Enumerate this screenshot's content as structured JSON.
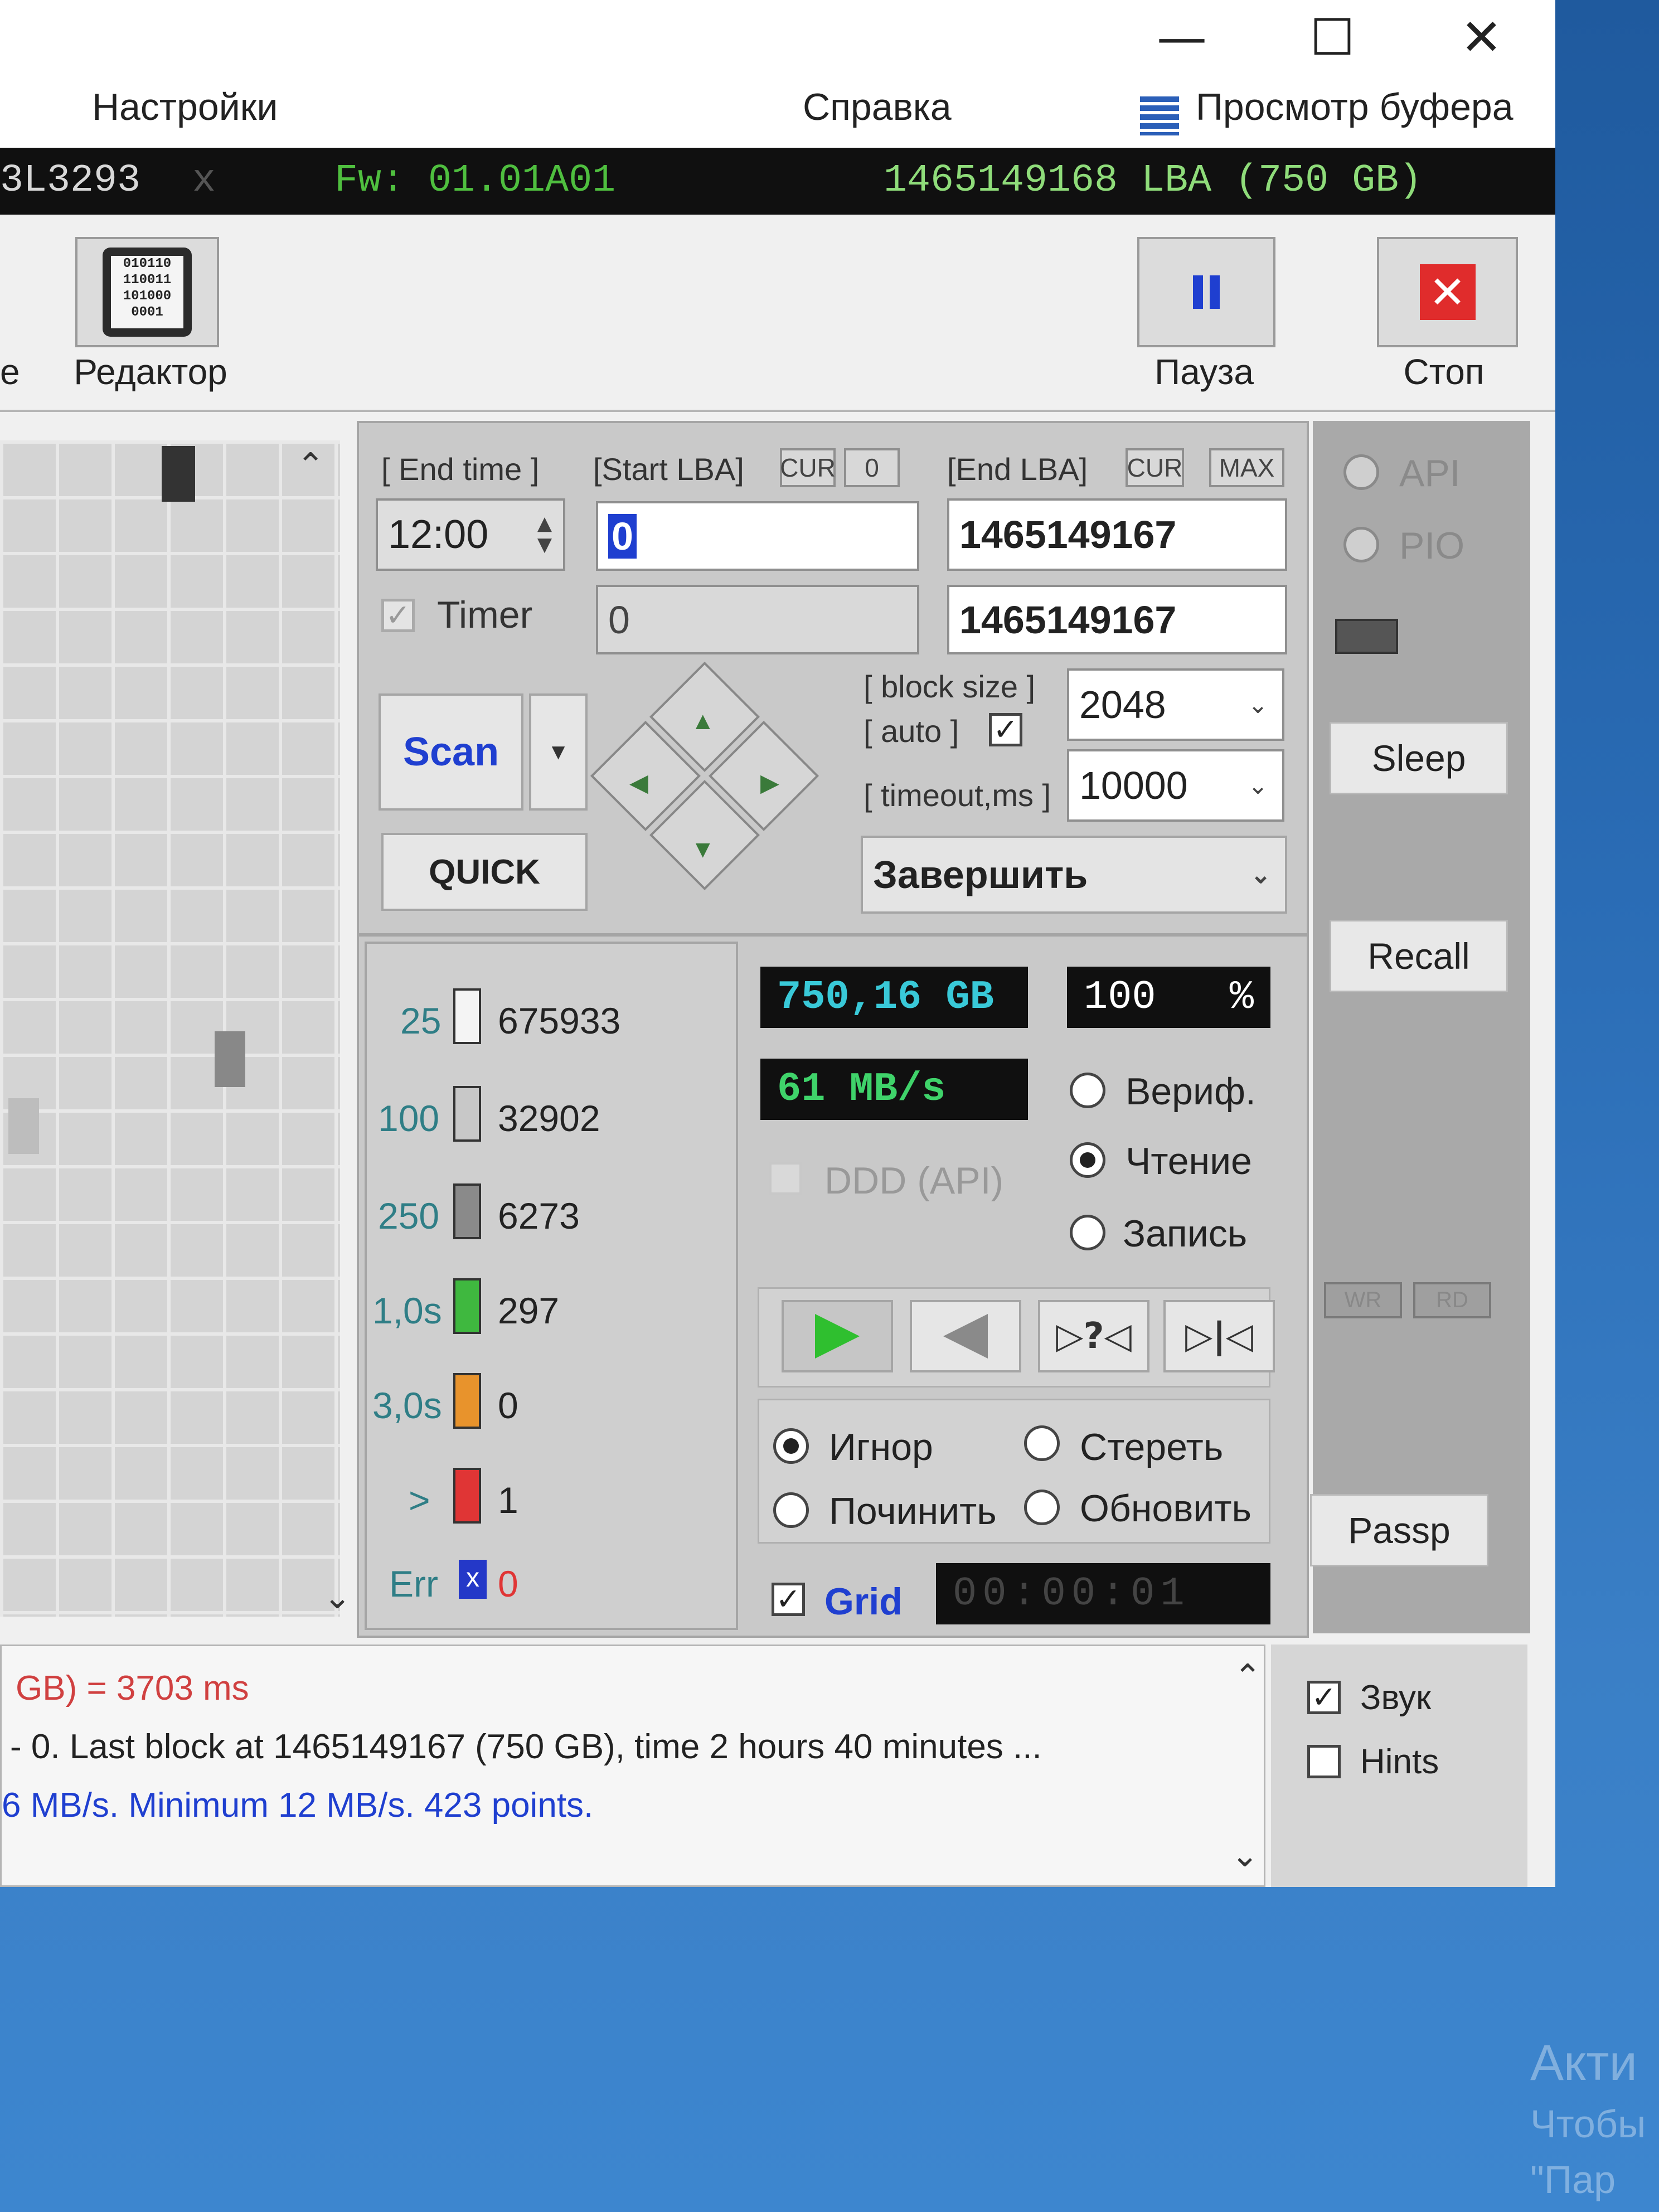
{
  "window_controls": {
    "minimize": "—",
    "maximize": "☐",
    "close": "✕"
  },
  "menu": {
    "settings": "Настройки",
    "help": "Справка",
    "buffer_view": "Просмотр буфера"
  },
  "infobar": {
    "model_fragment": "3L3293",
    "close_mark": "x",
    "firmware": "Fw: 01.01A01",
    "capacity": "1465149168 LBA (750 GB)"
  },
  "toolbar": {
    "left_fragment": "e",
    "editor": "Редактор",
    "editor_icon_text": "010110\n110011\n101000\n0001",
    "pause": "Пауза",
    "stop": "Стоп"
  },
  "scan_panel": {
    "end_time_label": "[ End time ]",
    "end_time_value": "12:00",
    "start_lba_label": "[Start LBA]",
    "cur1": "CUR",
    "zero_btn": "0",
    "end_lba_label": "[End LBA]",
    "cur2": "CUR",
    "max": "MAX",
    "start_lba_value": "0",
    "end_lba_value": "1465149167",
    "timer_label": "Timer",
    "timer_start_value": "0",
    "timer_end_value": "1465149167",
    "scan_button": "Scan",
    "quick_button": "QUICK",
    "block_size_label": "[ block size ]",
    "auto_label": "[ auto ]",
    "block_size_value": "2048",
    "timeout_label": "[ timeout,ms ]",
    "timeout_value": "10000",
    "finish_select": "Завершить"
  },
  "legend": [
    {
      "threshold": "25",
      "count": "675933",
      "color": "#f4f4f4"
    },
    {
      "threshold": "100",
      "count": "32902",
      "color": "#c8c8c8"
    },
    {
      "threshold": "250",
      "count": "6273",
      "color": "#8a8a8a"
    },
    {
      "threshold": "1,0s",
      "count": "297",
      "color": "#3fb83f"
    },
    {
      "threshold": "3,0s",
      "count": "0",
      "color": "#e8932c"
    },
    {
      "threshold": ">",
      "count": "1",
      "color": "#e03535"
    },
    {
      "threshold": "Err",
      "count": "0",
      "color": "#2438c8"
    }
  ],
  "stats": {
    "size": "750,16 GB",
    "percent": "100",
    "percent_sign": "%",
    "speed": "61 MB/s",
    "ddd": "DDD (API)"
  },
  "mode": {
    "verify": "Вериф.",
    "read": "Чтение",
    "write": "Запись"
  },
  "actions": {
    "ignore": "Игнор",
    "erase": "Стереть",
    "repair": "Починить",
    "refresh": "Обновить"
  },
  "grid": {
    "label": "Grid",
    "timer": "00:00:01"
  },
  "right_panel": {
    "api": "API",
    "pio": "PIO",
    "sleep": "Sleep",
    "recall": "Recall",
    "wr": "WR",
    "rd": "RD",
    "passp": "Passp"
  },
  "log": {
    "line1": "GB)  = 3703 ms",
    "line2": "- 0. Last block at 1465149167 (750 GB), time 2 hours 40 minutes ...",
    "line3": "6 MB/s. Minimum 12 MB/s. 423 points."
  },
  "options": {
    "sound": "Звук",
    "hints": "Hints"
  },
  "desktop_watermark": {
    "line1": "Акти",
    "line2": "Чтобы",
    "line3": "\"Пар"
  },
  "colors": {
    "lcd_cyan": "#39c9d8",
    "lcd_green": "#3fd36a",
    "lba_green": "#8fdc7a",
    "pause_blue": "#1f3fd0",
    "stop_red": "#e02c2c"
  }
}
